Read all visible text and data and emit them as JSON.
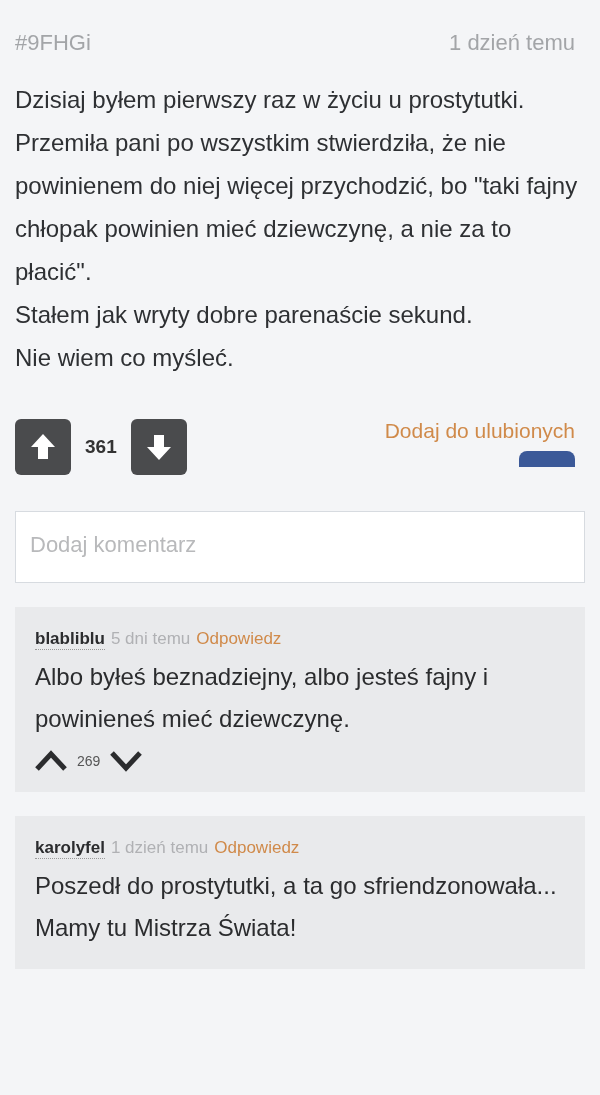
{
  "post": {
    "id": "#9FHGi",
    "time": "1 dzień temu",
    "paragraphs": [
      "Dzisiaj byłem pierwszy raz w życiu u prostytutki. Przemiła pani po wszystkim stwierdziła, że nie powinienem do niej więcej przychodzić, bo \"taki fajny chłopak powinien mieć dziewczynę, a nie za to płacić\".",
      "Stałem jak wryty dobre parenaście sekund.",
      "Nie wiem co myśleć."
    ],
    "score": "361",
    "favorite_link": "Dodaj do ulubionych"
  },
  "comment_field": {
    "placeholder": "Dodaj komentarz"
  },
  "comments": [
    {
      "author": "blabliblu",
      "time": "5 dni temu",
      "reply": "Odpowiedz",
      "text": "Albo byłeś beznadziejny, albo jesteś fajny i powinieneś mieć dziewczynę.",
      "score": "269"
    },
    {
      "author": "karolyfel",
      "time": "1 dzień temu",
      "reply": "Odpowiedz",
      "text": "Poszedł do prostytutki, a ta go sfriendzonowała... Mamy tu Mistrza Świata!"
    }
  ]
}
